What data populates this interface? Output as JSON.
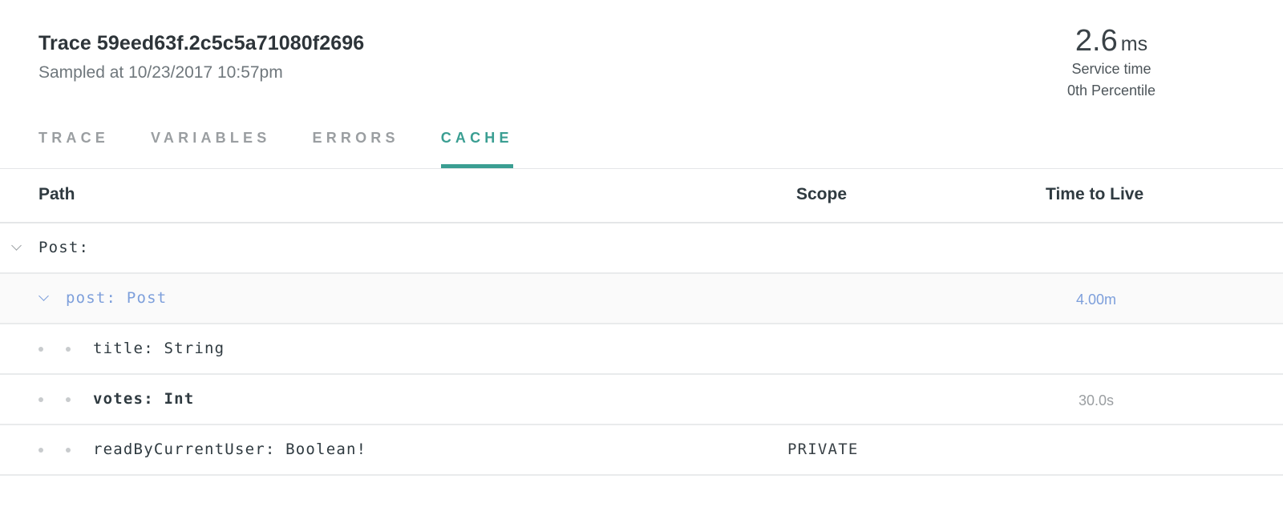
{
  "header": {
    "title": "Trace 59eed63f.2c5c5a71080f2696",
    "sampled": "Sampled at 10/23/2017 10:57pm"
  },
  "stat": {
    "value": "2.6",
    "unit": "ms",
    "label": "Service time",
    "percentile": "0th Percentile"
  },
  "tabs": [
    {
      "label": "TRACE",
      "active": false
    },
    {
      "label": "VARIABLES",
      "active": false
    },
    {
      "label": "ERRORS",
      "active": false
    },
    {
      "label": "CACHE",
      "active": true
    }
  ],
  "table": {
    "columns": {
      "path": "Path",
      "scope": "Scope",
      "ttl": "Time to Live"
    },
    "rows": [
      {
        "path": "Post:",
        "scope": "",
        "ttl": "",
        "icon": "chevron-down-icon"
      },
      {
        "path": "post: Post",
        "scope": "",
        "ttl": "4.00m",
        "icon": "chevron-down-icon"
      },
      {
        "path": "title: String",
        "scope": "",
        "ttl": "",
        "icon": "dot-icon"
      },
      {
        "path": "votes: Int",
        "scope": "",
        "ttl": "30.0s",
        "icon": "dot-icon"
      },
      {
        "path": "readByCurrentUser: Boolean!",
        "scope": "PRIVATE",
        "ttl": "",
        "icon": "dot-icon"
      }
    ]
  },
  "colors": {
    "accent": "#3a9e92",
    "link": "#7d9fdb",
    "muted": "#9a9ea1"
  }
}
